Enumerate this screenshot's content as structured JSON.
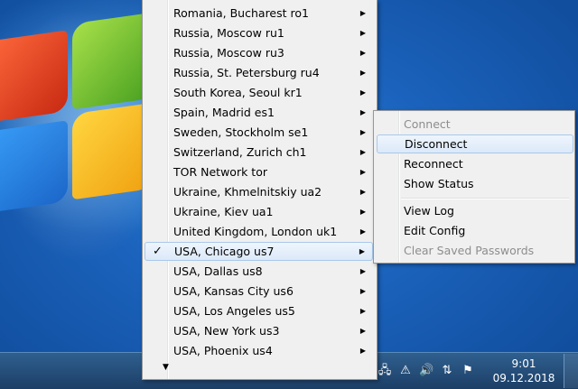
{
  "server_menu": {
    "items": [
      {
        "label": "Romania, Bucharest ro1"
      },
      {
        "label": "Russia, Moscow ru1"
      },
      {
        "label": "Russia, Moscow ru3"
      },
      {
        "label": "Russia, St. Petersburg ru4"
      },
      {
        "label": "South Korea, Seoul kr1"
      },
      {
        "label": "Spain, Madrid es1"
      },
      {
        "label": "Sweden, Stockholm se1"
      },
      {
        "label": "Switzerland, Zurich ch1"
      },
      {
        "label": "TOR Network tor"
      },
      {
        "label": "Ukraine, Khmelnitskiy ua2"
      },
      {
        "label": "Ukraine, Kiev ua1"
      },
      {
        "label": "United Kingdom, London uk1"
      },
      {
        "label": "USA, Chicago us7",
        "checked": true
      },
      {
        "label": "USA, Dallas us8"
      },
      {
        "label": "USA, Kansas City us6"
      },
      {
        "label": "USA, Los Angeles us5"
      },
      {
        "label": "USA, New York us3"
      },
      {
        "label": "USA, Phoenix us4"
      }
    ],
    "check_glyph": "✓",
    "submenu_arrow": "▶",
    "more_arrow": "▼"
  },
  "context_menu": {
    "connect": "Connect",
    "disconnect": "Disconnect",
    "reconnect": "Reconnect",
    "show_status": "Show Status",
    "view_log": "View Log",
    "edit_config": "Edit Config",
    "clear_saved_passwords": "Clear Saved Passwords"
  },
  "taskbar": {
    "time": "9:01",
    "date": "09.12.2018",
    "tray_icons": [
      "network-icon",
      "flag-warning-icon",
      "speaker-icon",
      "openvpn-icon",
      "action-center-icon"
    ]
  },
  "colors": {
    "desktop": "#1b63bd",
    "menu_bg": "#f0f0f0",
    "highlight_border": "#a8c8ea",
    "disabled_text": "#8d8d8d"
  }
}
